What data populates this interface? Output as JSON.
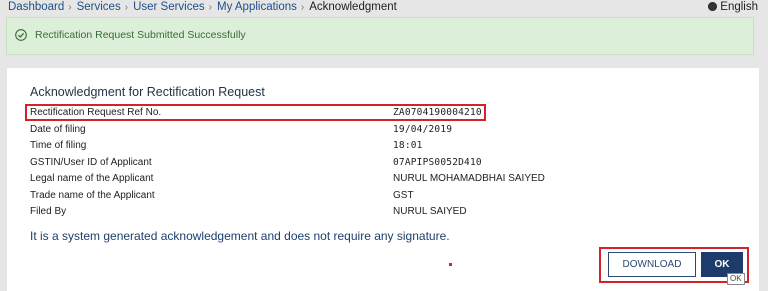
{
  "breadcrumb": {
    "items": [
      {
        "label": "Dashboard"
      },
      {
        "label": "Services"
      },
      {
        "label": "User Services"
      },
      {
        "label": "My Applications"
      }
    ],
    "current": "Acknowledgment",
    "separator": "›"
  },
  "language": {
    "label": "English",
    "icon": "globe-icon"
  },
  "alert": {
    "message": "Rectification Request Submitted Successfully",
    "icon": "check-icon",
    "color": "#3c6a3a",
    "background": "#dcefd8"
  },
  "acknowledgment": {
    "title": "Acknowledgment for Rectification Request",
    "fields": [
      {
        "label": "Rectification Request Ref No.",
        "value": "ZA0704190004210"
      },
      {
        "label": "Date of filing",
        "value": "19/04/2019"
      },
      {
        "label": "Time of filing",
        "value": "18:01"
      },
      {
        "label": "GSTIN/User ID of Applicant",
        "value": "07APIPS0052D410"
      },
      {
        "label": "Legal name of the Applicant",
        "value": "NURUL MOHAMADBHAI SAIYED"
      },
      {
        "label": "Trade name of the Applicant",
        "value": "GST"
      },
      {
        "label": "Filed By",
        "value": "NURUL SAIYED"
      }
    ],
    "note": "It is a system generated acknowledgement and does not require any signature."
  },
  "actions": {
    "download_label": "DOWNLOAD",
    "ok_label": "OK",
    "ok_tooltip": "OK"
  },
  "colors": {
    "highlight": "#d2232a",
    "primary": "#1d3c6b",
    "page_bg": "#e6e6e6"
  }
}
